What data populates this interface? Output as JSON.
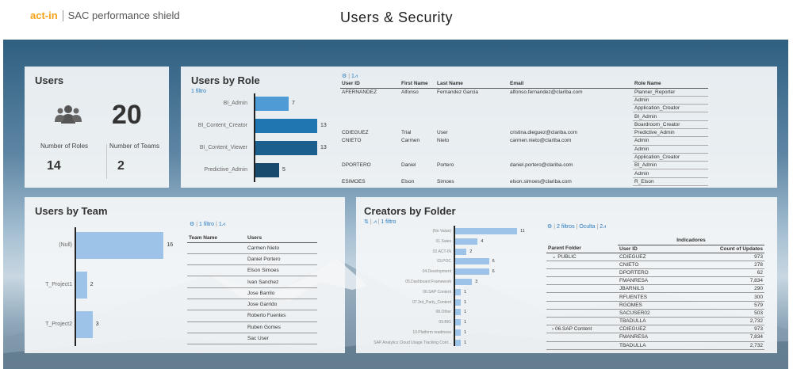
{
  "header": {
    "brand_logo": "act-in",
    "brand_name": "SAC performance shield",
    "title": "Users & Security"
  },
  "users_card": {
    "title": "Users",
    "count": "20",
    "roles_label": "Number of Roles",
    "roles_value": "14",
    "teams_label": "Number of Teams",
    "teams_value": "2"
  },
  "role_card": {
    "title": "Users by Role",
    "filter": "1 filtro",
    "table_tool": "1",
    "columns": [
      "User ID",
      "First Name",
      "Last Name",
      "Email",
      "Role Name"
    ],
    "rows": [
      [
        "AFERNANDEZ",
        "Alfonso",
        "Fernandez Garcia",
        "alfonso.fernandez@clariba.com",
        "Planner_Reporter"
      ],
      [
        "",
        "",
        "",
        "",
        "Admin"
      ],
      [
        "",
        "",
        "",
        "",
        "Application_Creator"
      ],
      [
        "",
        "",
        "",
        "",
        "BI_Admin"
      ],
      [
        "",
        "",
        "",
        "",
        "Boardroom_Creator"
      ],
      [
        "CDIEGUEZ",
        "Trial",
        "User",
        "cristina.dieguez@clariba.com",
        "Predictive_Admin"
      ],
      [
        "CNIETO",
        "Carmen",
        "Nieto",
        "carmen.nieto@clariba.com",
        "Admin"
      ],
      [
        "",
        "",
        "",
        "",
        "Admin"
      ],
      [
        "",
        "",
        "",
        "",
        "Application_Creator"
      ],
      [
        "DPORTERO",
        "Daniel",
        "Portero",
        "daniel.portero@clariba.com",
        "BI_Admin"
      ],
      [
        "",
        "",
        "",
        "",
        "Admin"
      ],
      [
        "ESIMOES",
        "Elson",
        "Simoes",
        "elson.simoes@clariba.com",
        "R_Elson"
      ]
    ]
  },
  "team_card": {
    "title": "Users by Team",
    "filter": "1 filtro",
    "table_tool": "1",
    "columns": [
      "Team Name",
      "Users"
    ],
    "users": [
      "Carmen Nieto",
      "Daniel Portero",
      "Elson Simoes",
      "Ivan Sanchez",
      "Jose Barrilo",
      "Jose Garrido",
      "Roberto Fuentes",
      "Ruben Gomes",
      "Sac User"
    ]
  },
  "folder_card": {
    "title": "Creators by Folder",
    "filter": "1 filtro",
    "filters2": "2 filtros",
    "hide": "Oculta",
    "table_tool": "2",
    "col_group": "Indicadores",
    "columns": [
      "Parent Folder",
      "User ID",
      "Count of Updates"
    ],
    "rows": [
      [
        "PUBLIC",
        "CDIEGUEZ",
        "973"
      ],
      [
        "",
        "CNIETO",
        "278"
      ],
      [
        "",
        "DPORTERO",
        "62"
      ],
      [
        "",
        "FMANRESA",
        "7,834"
      ],
      [
        "",
        "JBARNILS",
        "290"
      ],
      [
        "",
        "RFUENTES",
        "300"
      ],
      [
        "",
        "RGOMES",
        "579"
      ],
      [
        "",
        "SACUSER02",
        "503"
      ],
      [
        "",
        "TBADULLA",
        "2,732"
      ],
      [
        "06.SAP Content",
        "CDIEGUEZ",
        "973"
      ],
      [
        "",
        "FMANRESA",
        "7,834"
      ],
      [
        "",
        "TBADULLA",
        "2,732"
      ]
    ]
  },
  "chart_data": [
    {
      "type": "bar",
      "orientation": "horizontal",
      "title": "Users by Role",
      "categories": [
        "BI_Admin",
        "BI_Content_Creator",
        "BI_Content_Viewer",
        "Predictive_Admin"
      ],
      "values": [
        7,
        13,
        13,
        5
      ],
      "colors": [
        "#4f9bd6",
        "#1f76b0",
        "#1a5f8e",
        "#174a6d"
      ]
    },
    {
      "type": "bar",
      "orientation": "horizontal",
      "title": "Users by Team",
      "categories": [
        "(Null)",
        "T_Project1",
        "T_Project2"
      ],
      "values": [
        16,
        2,
        3
      ],
      "color": "#9ec3e8"
    },
    {
      "type": "bar",
      "orientation": "horizontal",
      "title": "Creators by Folder",
      "categories": [
        "(No Value)",
        "01.Sales",
        "02.ACT-IN",
        "03.POC",
        "04.Development",
        "05.Dashboard Framework",
        "06.SAP Content",
        "07.3rd_Party_Content",
        "08.Other",
        "09.BIG",
        "10.Platform readiness",
        "SAP Analytics Cloud Usage Tracking Cont..."
      ],
      "values": [
        11,
        4,
        2,
        6,
        6,
        3,
        1,
        1,
        1,
        1,
        1,
        1
      ],
      "color": "#9ec3e8"
    }
  ]
}
